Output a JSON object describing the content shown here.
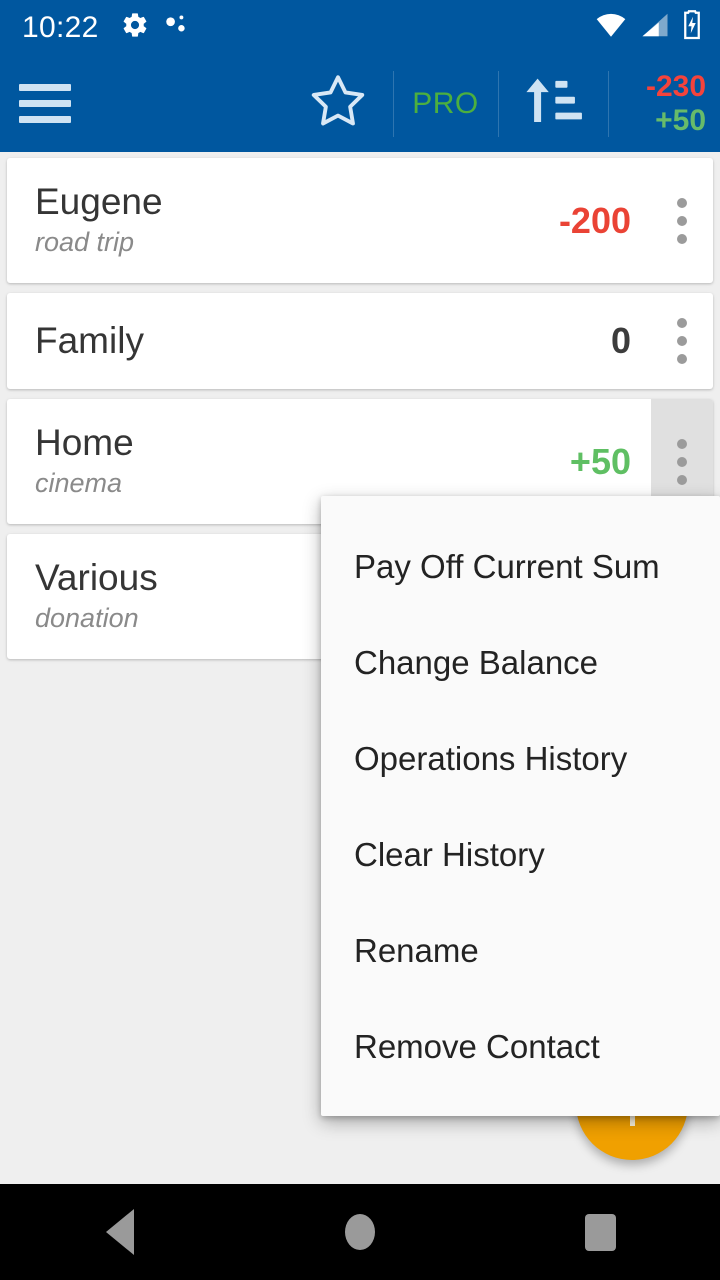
{
  "status_bar": {
    "time": "10:22",
    "left_icons": [
      "gear-icon",
      "debug-dots-icon"
    ],
    "right_icons": [
      "wifi-icon",
      "cellular-signal-icon",
      "battery-charging-icon"
    ],
    "background_color": "#00579F"
  },
  "app_bar": {
    "menu_icon": "hamburger-icon",
    "star_icon": "star-outline-icon",
    "pro_label": "PRO",
    "pro_color": "#4CAF3F",
    "sort_icon": "sort-ascending-icon",
    "total_negative": "-230",
    "total_positive": "+50",
    "negative_color": "#F4433C",
    "positive_color": "#67BB6A",
    "background_color": "#00579F"
  },
  "contacts": [
    {
      "name": "Eugene",
      "note": "road trip",
      "amount": "-200",
      "sign": "neg",
      "menu_open": false
    },
    {
      "name": "Family",
      "note": "",
      "amount": "0",
      "sign": "zero",
      "menu_open": false
    },
    {
      "name": "Home",
      "note": "cinema",
      "amount": "+50",
      "sign": "pos",
      "menu_open": true
    },
    {
      "name": "Various",
      "note": "donation",
      "amount": "",
      "sign": "none",
      "menu_open": false
    }
  ],
  "context_menu": {
    "for_contact": "Home",
    "items": [
      "Pay Off Current Sum",
      "Change Balance",
      "Operations History",
      "Clear History",
      "Rename",
      "Remove Contact"
    ]
  },
  "fab": {
    "icon": "plus-icon",
    "color": "#F0A000"
  },
  "nav_bar": {
    "buttons": [
      "back-icon",
      "home-icon",
      "recents-icon"
    ],
    "background_color": "#000000",
    "icon_color": "#9A9A9A"
  },
  "colors": {
    "page_background": "#EFEFEF",
    "card_background": "#FFFFFF",
    "amount_negative": "#EA4335",
    "amount_positive": "#5FBF63",
    "amount_zero": "#3C3C3C"
  }
}
